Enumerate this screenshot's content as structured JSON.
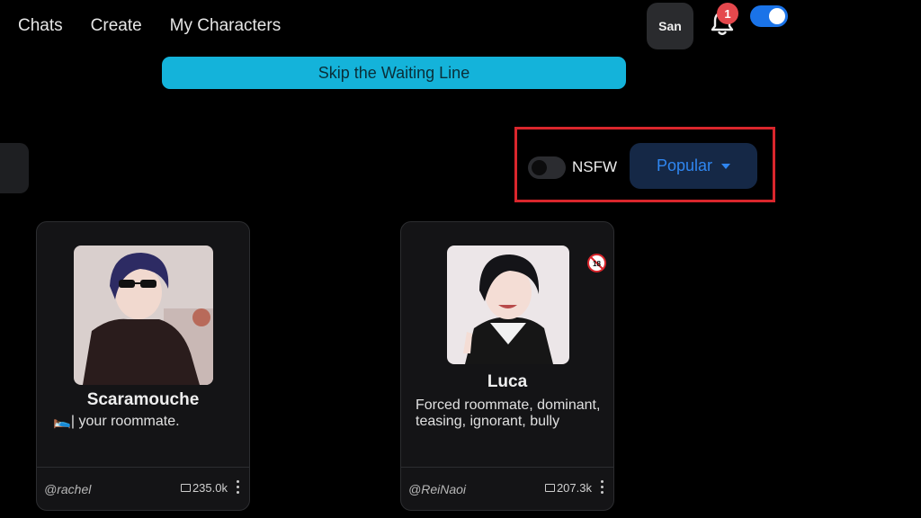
{
  "nav": {
    "chats": "Chats",
    "create": "Create",
    "my_characters": "My Characters"
  },
  "header": {
    "avatar_label": "San",
    "notification_count": "1",
    "top_toggle_on": true,
    "accent": "#1a73e8"
  },
  "banner": {
    "label": "Skip the Waiting Line",
    "color": "#14b3da"
  },
  "filters": {
    "nsfw_label": "NSFW",
    "nsfw_on": false,
    "sort_label": "Popular",
    "highlight_color": "#d9262c"
  },
  "cards": [
    {
      "name": "Scaramouche",
      "description": "| your roommate.",
      "description_icon": "person-in-bed-emoji",
      "author": "@rachel",
      "count": "235.0k"
    },
    {
      "name": "Luca",
      "description": "Forced roommate, dominant, teasing, ignorant, bully",
      "author": "@ReiNaoi",
      "count": "207.3k",
      "badge": "18"
    }
  ]
}
